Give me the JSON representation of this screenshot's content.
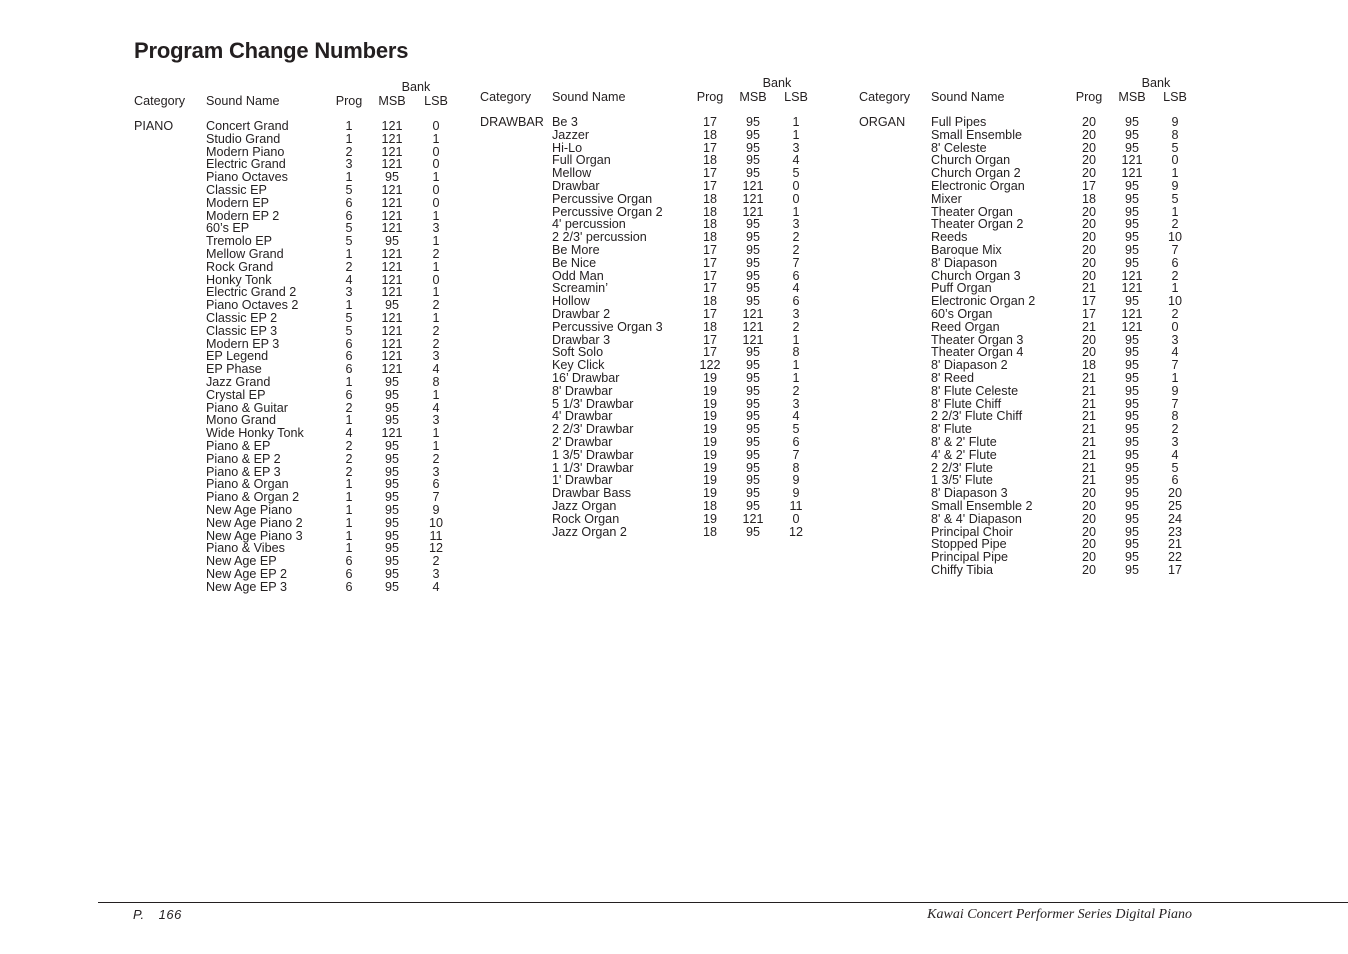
{
  "page": {
    "title": "Program Change Numbers",
    "footer": {
      "page_prefix": "P.",
      "page_number": "166",
      "brand": "Kawai Concert Performer Series Digital Piano"
    }
  },
  "headers": {
    "bank": "Bank",
    "category": "Category",
    "sound_name": "Sound Name",
    "prog": "Prog",
    "msb": "MSB",
    "lsb": "LSB"
  },
  "tables": [
    {
      "category": "PIANO",
      "rows": [
        {
          "name": "Concert Grand",
          "prog": "1",
          "msb": "121",
          "lsb": "0"
        },
        {
          "name": "Studio Grand",
          "prog": "1",
          "msb": "121",
          "lsb": "1"
        },
        {
          "name": "Modern Piano",
          "prog": "2",
          "msb": "121",
          "lsb": "0"
        },
        {
          "name": "Electric Grand",
          "prog": "3",
          "msb": "121",
          "lsb": "0"
        },
        {
          "name": "Piano Octaves",
          "prog": "1",
          "msb": "95",
          "lsb": "1"
        },
        {
          "name": "Classic EP",
          "prog": "5",
          "msb": "121",
          "lsb": "0"
        },
        {
          "name": "Modern EP",
          "prog": "6",
          "msb": "121",
          "lsb": "0"
        },
        {
          "name": "Modern EP 2",
          "prog": "6",
          "msb": "121",
          "lsb": "1"
        },
        {
          "name": "60’s EP",
          "prog": "5",
          "msb": "121",
          "lsb": "3"
        },
        {
          "name": "Tremolo EP",
          "prog": "5",
          "msb": "95",
          "lsb": "1"
        },
        {
          "name": "Mellow Grand",
          "prog": "1",
          "msb": "121",
          "lsb": "2"
        },
        {
          "name": "Rock Grand",
          "prog": "2",
          "msb": "121",
          "lsb": "1"
        },
        {
          "name": "Honky Tonk",
          "prog": "4",
          "msb": "121",
          "lsb": "0"
        },
        {
          "name": "Electric Grand 2",
          "prog": "3",
          "msb": "121",
          "lsb": "1"
        },
        {
          "name": "Piano Octaves 2",
          "prog": "1",
          "msb": "95",
          "lsb": "2"
        },
        {
          "name": "Classic EP 2",
          "prog": "5",
          "msb": "121",
          "lsb": "1"
        },
        {
          "name": "Classic EP 3",
          "prog": "5",
          "msb": "121",
          "lsb": "2"
        },
        {
          "name": "Modern EP 3",
          "prog": "6",
          "msb": "121",
          "lsb": "2"
        },
        {
          "name": "EP Legend",
          "prog": "6",
          "msb": "121",
          "lsb": "3"
        },
        {
          "name": "EP Phase",
          "prog": "6",
          "msb": "121",
          "lsb": "4"
        },
        {
          "name": "Jazz Grand",
          "prog": "1",
          "msb": "95",
          "lsb": "8"
        },
        {
          "name": "Crystal EP",
          "prog": "6",
          "msb": "95",
          "lsb": "1"
        },
        {
          "name": "Piano & Guitar",
          "prog": "2",
          "msb": "95",
          "lsb": "4"
        },
        {
          "name": "Mono Grand",
          "prog": "1",
          "msb": "95",
          "lsb": "3"
        },
        {
          "name": "Wide Honky Tonk",
          "prog": "4",
          "msb": "121",
          "lsb": "1"
        },
        {
          "name": "Piano & EP",
          "prog": "2",
          "msb": "95",
          "lsb": "1"
        },
        {
          "name": "Piano & EP 2",
          "prog": "2",
          "msb": "95",
          "lsb": "2"
        },
        {
          "name": "Piano & EP 3",
          "prog": "2",
          "msb": "95",
          "lsb": "3"
        },
        {
          "name": "Piano & Organ",
          "prog": "1",
          "msb": "95",
          "lsb": "6"
        },
        {
          "name": "Piano & Organ 2",
          "prog": "1",
          "msb": "95",
          "lsb": "7"
        },
        {
          "name": "New Age Piano",
          "prog": "1",
          "msb": "95",
          "lsb": "9"
        },
        {
          "name": "New Age Piano 2",
          "prog": "1",
          "msb": "95",
          "lsb": "10"
        },
        {
          "name": "New Age Piano 3",
          "prog": "1",
          "msb": "95",
          "lsb": "11"
        },
        {
          "name": "Piano & Vibes",
          "prog": "1",
          "msb": "95",
          "lsb": "12"
        },
        {
          "name": "New Age EP",
          "prog": "6",
          "msb": "95",
          "lsb": "2"
        },
        {
          "name": "New Age EP 2",
          "prog": "6",
          "msb": "95",
          "lsb": "3"
        },
        {
          "name": "New Age EP 3",
          "prog": "6",
          "msb": "95",
          "lsb": "4"
        }
      ]
    },
    {
      "category": "DRAWBAR",
      "rows": [
        {
          "name": "Be 3",
          "prog": "17",
          "msb": "95",
          "lsb": "1"
        },
        {
          "name": "Jazzer",
          "prog": "18",
          "msb": "95",
          "lsb": "1"
        },
        {
          "name": "Hi-Lo",
          "prog": "17",
          "msb": "95",
          "lsb": "3"
        },
        {
          "name": "Full Organ",
          "prog": "18",
          "msb": "95",
          "lsb": "4"
        },
        {
          "name": "Mellow",
          "prog": "17",
          "msb": "95",
          "lsb": "5"
        },
        {
          "name": "Drawbar",
          "prog": "17",
          "msb": "121",
          "lsb": "0"
        },
        {
          "name": "Percussive Organ",
          "prog": "18",
          "msb": "121",
          "lsb": "0"
        },
        {
          "name": "Percussive Organ 2",
          "prog": "18",
          "msb": "121",
          "lsb": "1"
        },
        {
          "name": "4' percussion",
          "prog": "18",
          "msb": "95",
          "lsb": "3"
        },
        {
          "name": "2 2/3' percussion",
          "prog": "18",
          "msb": "95",
          "lsb": "2"
        },
        {
          "name": "Be More",
          "prog": "17",
          "msb": "95",
          "lsb": "2"
        },
        {
          "name": "Be Nice",
          "prog": "17",
          "msb": "95",
          "lsb": "7"
        },
        {
          "name": "Odd Man",
          "prog": "17",
          "msb": "95",
          "lsb": "6"
        },
        {
          "name": "Screamin’",
          "prog": "17",
          "msb": "95",
          "lsb": "4"
        },
        {
          "name": "Hollow",
          "prog": "18",
          "msb": "95",
          "lsb": "6"
        },
        {
          "name": "Drawbar 2",
          "prog": "17",
          "msb": "121",
          "lsb": "3"
        },
        {
          "name": "Percussive Organ 3",
          "prog": "18",
          "msb": "121",
          "lsb": "2"
        },
        {
          "name": "Drawbar 3",
          "prog": "17",
          "msb": "121",
          "lsb": "1"
        },
        {
          "name": "Soft Solo",
          "prog": "17",
          "msb": "95",
          "lsb": "8"
        },
        {
          "name": "Key Click",
          "prog": "122",
          "msb": "95",
          "lsb": "1"
        },
        {
          "name": "16’ Drawbar",
          "prog": "19",
          "msb": "95",
          "lsb": "1"
        },
        {
          "name": "8' Drawbar",
          "prog": "19",
          "msb": "95",
          "lsb": "2"
        },
        {
          "name": "5 1/3' Drawbar",
          "prog": "19",
          "msb": "95",
          "lsb": "3"
        },
        {
          "name": "4' Drawbar",
          "prog": "19",
          "msb": "95",
          "lsb": "4"
        },
        {
          "name": "2 2/3' Drawbar",
          "prog": "19",
          "msb": "95",
          "lsb": "5"
        },
        {
          "name": "2' Drawbar",
          "prog": "19",
          "msb": "95",
          "lsb": "6"
        },
        {
          "name": "1 3/5' Drawbar",
          "prog": "19",
          "msb": "95",
          "lsb": "7"
        },
        {
          "name": "1 1/3' Drawbar",
          "prog": "19",
          "msb": "95",
          "lsb": "8"
        },
        {
          "name": "1' Drawbar",
          "prog": "19",
          "msb": "95",
          "lsb": "9"
        },
        {
          "name": "Drawbar Bass",
          "prog": "19",
          "msb": "95",
          "lsb": "9"
        },
        {
          "name": "Jazz Organ",
          "prog": "18",
          "msb": "95",
          "lsb": "11"
        },
        {
          "name": "Rock Organ",
          "prog": "19",
          "msb": "121",
          "lsb": "0"
        },
        {
          "name": "Jazz Organ 2",
          "prog": "18",
          "msb": "95",
          "lsb": "12"
        }
      ]
    },
    {
      "category": "ORGAN",
      "rows": [
        {
          "name": "Full Pipes",
          "prog": "20",
          "msb": "95",
          "lsb": "9"
        },
        {
          "name": "Small Ensemble",
          "prog": "20",
          "msb": "95",
          "lsb": "8"
        },
        {
          "name": "8' Celeste",
          "prog": "20",
          "msb": "95",
          "lsb": "5"
        },
        {
          "name": "Church Organ",
          "prog": "20",
          "msb": "121",
          "lsb": "0"
        },
        {
          "name": "Church Organ 2",
          "prog": "20",
          "msb": "121",
          "lsb": "1"
        },
        {
          "name": "Electronic Organ",
          "prog": "17",
          "msb": "95",
          "lsb": "9"
        },
        {
          "name": "Mixer",
          "prog": "18",
          "msb": "95",
          "lsb": "5"
        },
        {
          "name": "Theater Organ",
          "prog": "20",
          "msb": "95",
          "lsb": "1"
        },
        {
          "name": "Theater Organ 2",
          "prog": "20",
          "msb": "95",
          "lsb": "2"
        },
        {
          "name": "Reeds",
          "prog": "20",
          "msb": "95",
          "lsb": "10"
        },
        {
          "name": "Baroque Mix",
          "prog": "20",
          "msb": "95",
          "lsb": "7"
        },
        {
          "name": "8' Diapason",
          "prog": "20",
          "msb": "95",
          "lsb": "6"
        },
        {
          "name": "Church Organ 3",
          "prog": "20",
          "msb": "121",
          "lsb": "2"
        },
        {
          "name": "Puff Organ",
          "prog": "21",
          "msb": "121",
          "lsb": "1"
        },
        {
          "name": "Electronic Organ 2",
          "prog": "17",
          "msb": "95",
          "lsb": "10"
        },
        {
          "name": "60’s Organ",
          "prog": "17",
          "msb": "121",
          "lsb": "2"
        },
        {
          "name": "Reed Organ",
          "prog": "21",
          "msb": "121",
          "lsb": "0"
        },
        {
          "name": "Theater Organ 3",
          "prog": "20",
          "msb": "95",
          "lsb": "3"
        },
        {
          "name": "Theater Organ 4",
          "prog": "20",
          "msb": "95",
          "lsb": "4"
        },
        {
          "name": "8' Diapason 2",
          "prog": "18",
          "msb": "95",
          "lsb": "7"
        },
        {
          "name": "8' Reed",
          "prog": "21",
          "msb": "95",
          "lsb": "1"
        },
        {
          "name": "8' Flute Celeste",
          "prog": "21",
          "msb": "95",
          "lsb": "9"
        },
        {
          "name": "8' Flute Chiff",
          "prog": "21",
          "msb": "95",
          "lsb": "7"
        },
        {
          "name": "2 2/3' Flute Chiff",
          "prog": "21",
          "msb": "95",
          "lsb": "8"
        },
        {
          "name": "8' Flute",
          "prog": "21",
          "msb": "95",
          "lsb": "2"
        },
        {
          "name": "8' & 2' Flute",
          "prog": "21",
          "msb": "95",
          "lsb": "3"
        },
        {
          "name": "4' & 2' Flute",
          "prog": "21",
          "msb": "95",
          "lsb": "4"
        },
        {
          "name": "2 2/3' Flute",
          "prog": "21",
          "msb": "95",
          "lsb": "5"
        },
        {
          "name": "1 3/5' Flute",
          "prog": "21",
          "msb": "95",
          "lsb": "6"
        },
        {
          "name": "8' Diapason 3",
          "prog": "20",
          "msb": "95",
          "lsb": "20"
        },
        {
          "name": "Small Ensemble 2",
          "prog": "20",
          "msb": "95",
          "lsb": "25"
        },
        {
          "name": "8' & 4' Diapason",
          "prog": "20",
          "msb": "95",
          "lsb": "24"
        },
        {
          "name": "Principal Choir",
          "prog": "20",
          "msb": "95",
          "lsb": "23"
        },
        {
          "name": "Stopped Pipe",
          "prog": "20",
          "msb": "95",
          "lsb": "21"
        },
        {
          "name": "Principal Pipe",
          "prog": "20",
          "msb": "95",
          "lsb": "22"
        },
        {
          "name": "Chiffy Tibia",
          "prog": "20",
          "msb": "95",
          "lsb": "17"
        }
      ]
    }
  ]
}
